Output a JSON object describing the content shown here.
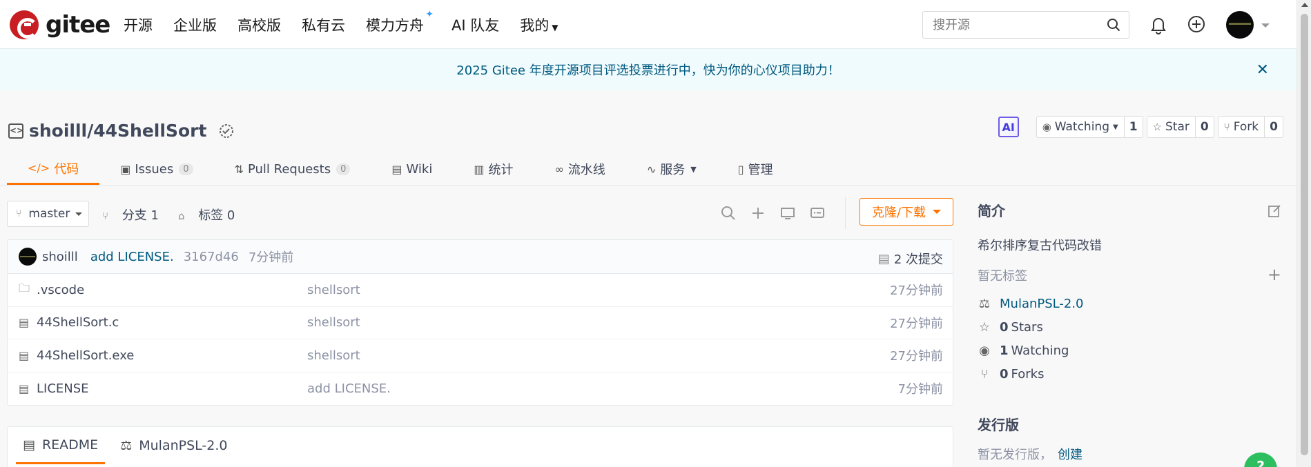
{
  "nav": {
    "logo_text": "gitee",
    "links": [
      "开源",
      "企业版",
      "高校版",
      "私有云",
      "模力方舟",
      "AI 队友",
      "我的"
    ],
    "search_placeholder": "搜开源"
  },
  "banner": {
    "text": "2025 Gitee 年度开源项目评选投票进行中，快为你的心仪项目助力！",
    "close": "✕"
  },
  "repo": {
    "name": "shoilll/44ShellSort",
    "ai_label": "AI",
    "watching_label": "Watching",
    "watching_count": "1",
    "star_label": "Star",
    "star_count": "0",
    "fork_label": "Fork",
    "fork_count": "0"
  },
  "tabs": [
    {
      "label": "代码",
      "icon": "code-icon"
    },
    {
      "label": "Issues",
      "count": "0",
      "icon": "issues-icon"
    },
    {
      "label": "Pull Requests",
      "count": "0",
      "icon": "pull-request-icon"
    },
    {
      "label": "Wiki",
      "icon": "wiki-icon"
    },
    {
      "label": "统计",
      "icon": "stats-icon"
    },
    {
      "label": "流水线",
      "icon": "pipeline-icon"
    },
    {
      "label": "服务",
      "icon": "service-icon"
    },
    {
      "label": "管理",
      "icon": "manage-icon"
    }
  ],
  "branch": {
    "current": "master",
    "branches_label": "分支 1",
    "tags_label": "标签 0",
    "clone_label": "克隆/下载"
  },
  "commit": {
    "user": "shoilll",
    "message": "add LICENSE.",
    "hash": "3167d46",
    "time": "7分钟前",
    "count_label": "2 次提交"
  },
  "files": [
    {
      "name": ".vscode",
      "type": "folder",
      "message": "shellsort",
      "time": "27分钟前"
    },
    {
      "name": "44ShellSort.c",
      "type": "file",
      "message": "shellsort",
      "time": "27分钟前"
    },
    {
      "name": "44ShellSort.exe",
      "type": "file",
      "message": "shellsort",
      "time": "27分钟前"
    },
    {
      "name": "LICENSE",
      "type": "file",
      "message": "add LICENSE.",
      "time": "7分钟前"
    }
  ],
  "readme_tabs": [
    "README",
    "MulanPSL-2.0"
  ],
  "sidebar": {
    "intro_title": "简介",
    "description": "希尔排序复古代码改错",
    "no_tags": "暂无标签",
    "license": "MulanPSL-2.0",
    "stars_num": "0",
    "stars_label": "Stars",
    "watching_num": "1",
    "watching_label": "Watching",
    "forks_num": "0",
    "forks_label": "Forks",
    "release_title": "发行版",
    "no_release": "暂无发行版，",
    "create_link": "创建"
  },
  "colors": {
    "accent": "#fe7300",
    "link": "#005980",
    "brand": "#c71d23"
  }
}
